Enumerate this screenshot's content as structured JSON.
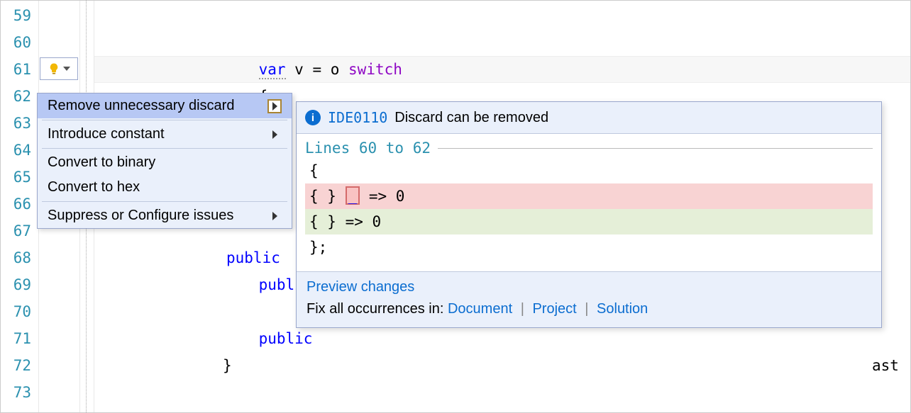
{
  "line_numbers": [
    "59",
    "60",
    "61",
    "62",
    "63",
    "64",
    "65",
    "66",
    "67",
    "68",
    "69",
    "70",
    "71",
    "72",
    "73"
  ],
  "code": {
    "l59_pre": "                  ",
    "l59_kw": "var",
    "l59_mid": " v = o ",
    "l59_kw2": "switch",
    "l60": "                  {",
    "l61": "                      { } _ => 0",
    "l69_pre": "                  ",
    "l69_kw": "public",
    "l71_pre": "                  ",
    "l71_kw": "public",
    "l72": "              }",
    "bg_public": "public",
    "bg_tail": "ast"
  },
  "bulb": {
    "tooltip": "Quick Actions"
  },
  "menu": {
    "items": [
      {
        "label": "Remove unnecessary discard",
        "has_sub": true,
        "selected": true
      },
      {
        "label": "Introduce constant",
        "has_sub": true
      },
      {
        "label": "Convert to binary"
      },
      {
        "label": "Convert to hex"
      },
      {
        "label": "Suppress or Configure issues",
        "has_sub": true
      }
    ]
  },
  "preview": {
    "rule_id": "IDE0110",
    "rule_desc": "Discard can be removed",
    "lines_label": "Lines 60 to 62",
    "diff": {
      "open": "{",
      "del_pre": "    { } ",
      "del_discard": "_",
      "del_post": " => 0",
      "add": "    { } => 0",
      "close": "};"
    },
    "footer": {
      "preview_link": "Preview changes",
      "fix_label": "Fix all occurrences in: ",
      "doc": "Document",
      "proj": "Project",
      "sol": "Solution"
    }
  }
}
